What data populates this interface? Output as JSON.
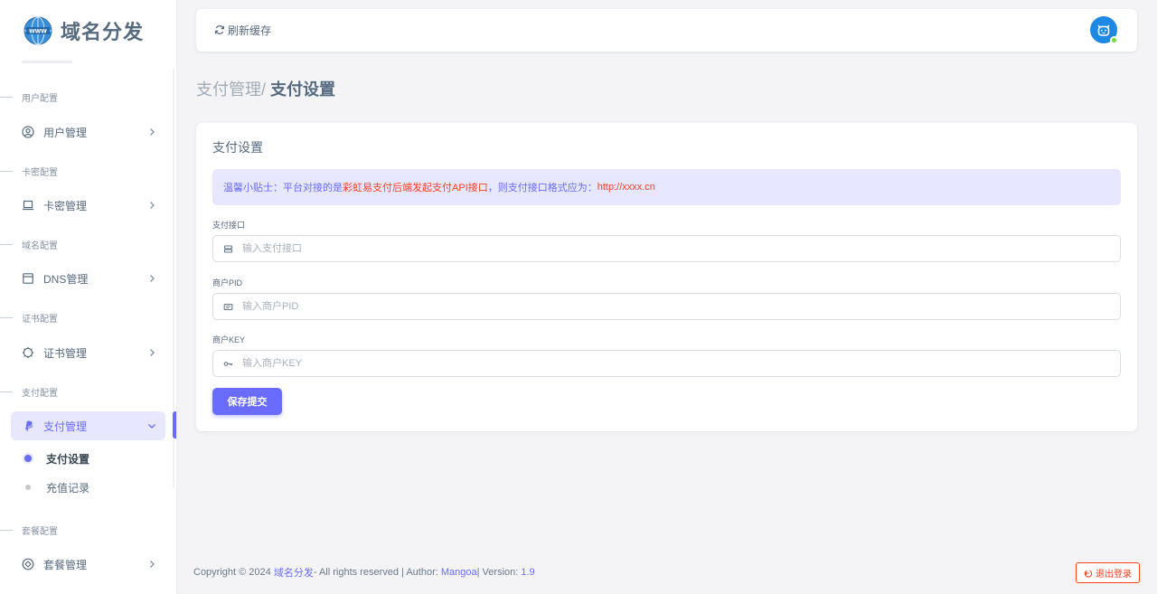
{
  "brand": {
    "name": "域名分发",
    "logo_icon": "globe-www-icon"
  },
  "sidebar": {
    "sections": [
      {
        "header": "用户配置",
        "item": {
          "label": "用户管理",
          "icon": "user-circle-icon"
        }
      },
      {
        "header": "卡密配置",
        "item": {
          "label": "卡密管理",
          "icon": "laptop-icon"
        }
      },
      {
        "header": "域名配置",
        "item": {
          "label": "DNS管理",
          "icon": "window-icon"
        }
      },
      {
        "header": "证书配置",
        "item": {
          "label": "证书管理",
          "icon": "chip-icon"
        }
      },
      {
        "header": "支付配置",
        "item": {
          "label": "支付管理",
          "icon": "paypal-icon"
        }
      },
      {
        "header": "套餐配置",
        "item": {
          "label": "套餐管理",
          "icon": "package-icon"
        }
      }
    ],
    "pay_submenu": [
      {
        "label": "支付设置",
        "active": true
      },
      {
        "label": "充值记录",
        "active": false
      }
    ]
  },
  "navbar": {
    "refresh_label": "刷新缓存",
    "avatar_icon": "cat-avatar-icon"
  },
  "breadcrumb": {
    "parent": "支付管理/",
    "current": "支付设置"
  },
  "card": {
    "title": "支付设置",
    "alert": {
      "part1": "温馨小贴士：平台对接的是",
      "part2": "彩虹易支付后端发起支付API接口",
      "part3": "，则支付接口格式应为：",
      "part4": "http://xxxx.cn"
    },
    "fields": [
      {
        "label": "支付接口",
        "placeholder": "输入支付接口",
        "value": "",
        "icon": "server-icon"
      },
      {
        "label": "商户PID",
        "placeholder": "输入商户PID",
        "value": "",
        "icon": "id-card-icon"
      },
      {
        "label": "商户KEY",
        "placeholder": "输入商户KEY",
        "value": "",
        "icon": "key-icon"
      }
    ],
    "save_label": "保存提交"
  },
  "footer": {
    "copyright": "Copyright © 2024",
    "site": "域名分发",
    "rights": " - All rights reserved | Author: ",
    "author": "Mangoa",
    "version_label": " | Version: ",
    "version": "1.9"
  },
  "logout_label": "退出登录",
  "colors": {
    "primary": "#696cff",
    "danger": "#ff3e1d",
    "text": "#566a7f",
    "bg": "#f4f4f7"
  }
}
